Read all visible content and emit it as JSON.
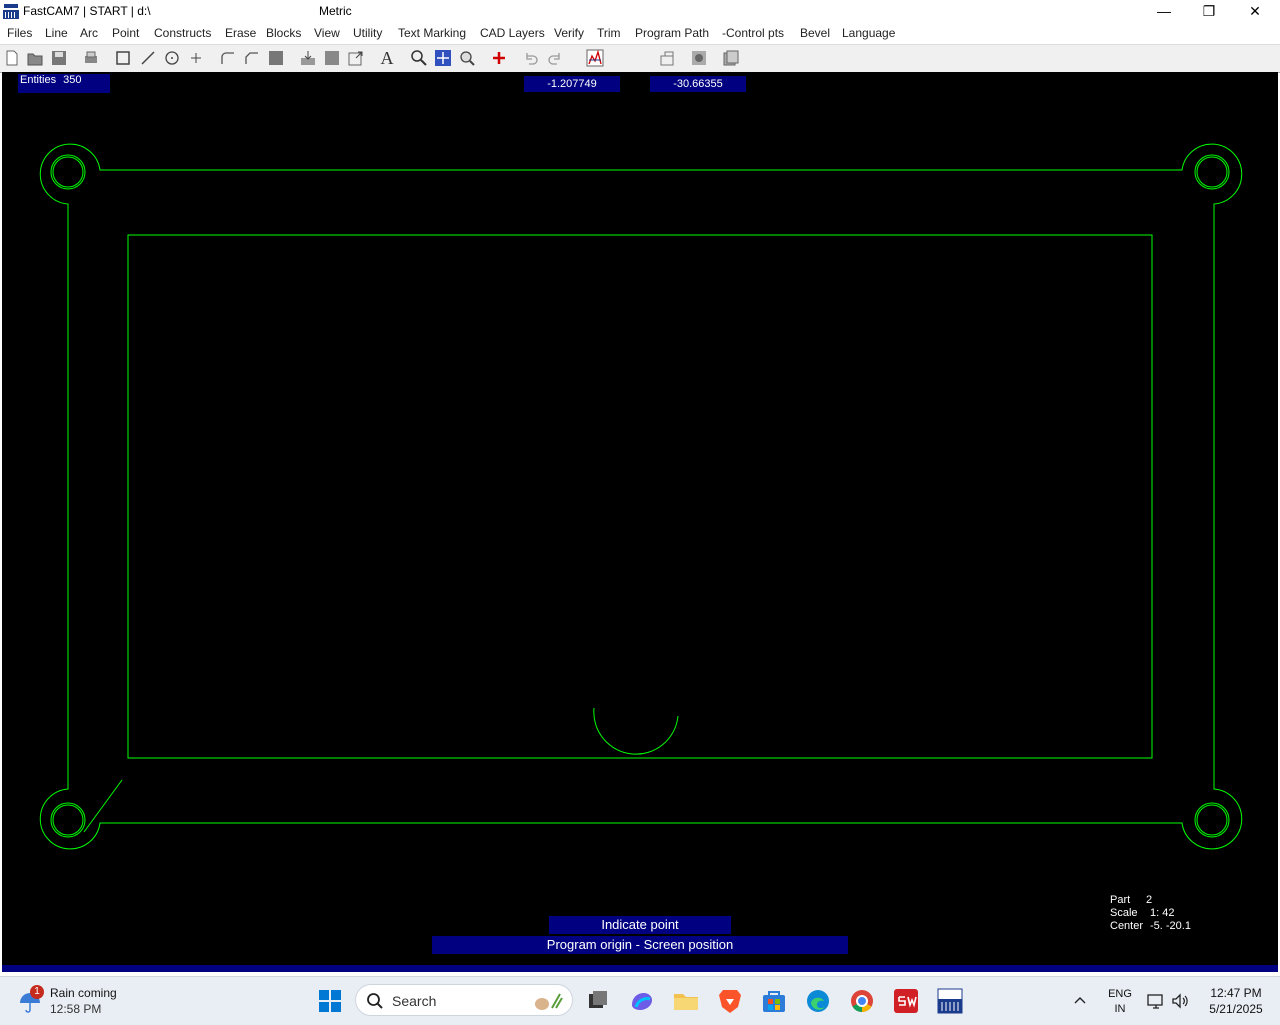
{
  "titlebar": {
    "app_title": "FastCAM7  |  START  |  d:\\",
    "doc_title": "Metric",
    "minimize": "—",
    "maximize": "❐",
    "close": "✕"
  },
  "menu": [
    "Files",
    "Line",
    "Arc",
    "Point",
    "Constructs",
    "Erase",
    "Blocks",
    "View",
    "Utility",
    "Text Marking",
    "CAD Layers",
    "Verify",
    "Trim",
    "Program Path",
    "-Control pts",
    "Bevel",
    "Language"
  ],
  "toolbar": {
    "icons": [
      "new-file-icon",
      "open-folder-icon",
      "save-icon",
      "print-icon",
      "rectangle-icon",
      "line-icon",
      "circle-icon",
      "point-icon",
      "fillet-icon",
      "chamfer-icon",
      "fill-icon",
      "block-in-icon",
      "block-fill-icon",
      "block-out-icon",
      "text-icon",
      "zoom-window-icon",
      "zoom-extents-icon",
      "zoom-icon",
      "origin-cross-icon",
      "undo-icon",
      "redo-icon",
      "verify-path-icon",
      "program-path-icon",
      "nest-icon",
      "batch-icon"
    ],
    "text_glyph": "A"
  },
  "canvas": {
    "entities_label": "Entities",
    "entities_count": "350",
    "coord_x": "-1.207749",
    "coord_y": "-30.66355",
    "line_color": "#00ff00",
    "info": {
      "part_label": "Part",
      "part_value": "2",
      "scale_label": "Scale",
      "scale_value": "1: 42",
      "center_label": "Center",
      "center_value": "-5. -20.1"
    },
    "prompt": "Indicate point",
    "status": "Program origin - Screen position"
  },
  "taskbar": {
    "weather_badge": "1",
    "weather_title": "Rain coming",
    "weather_time": "12:58 PM",
    "search_label": "Search",
    "lang_line1": "ENG",
    "lang_line2": "IN",
    "clock_time": "12:47 PM",
    "clock_date": "5/21/2025"
  }
}
